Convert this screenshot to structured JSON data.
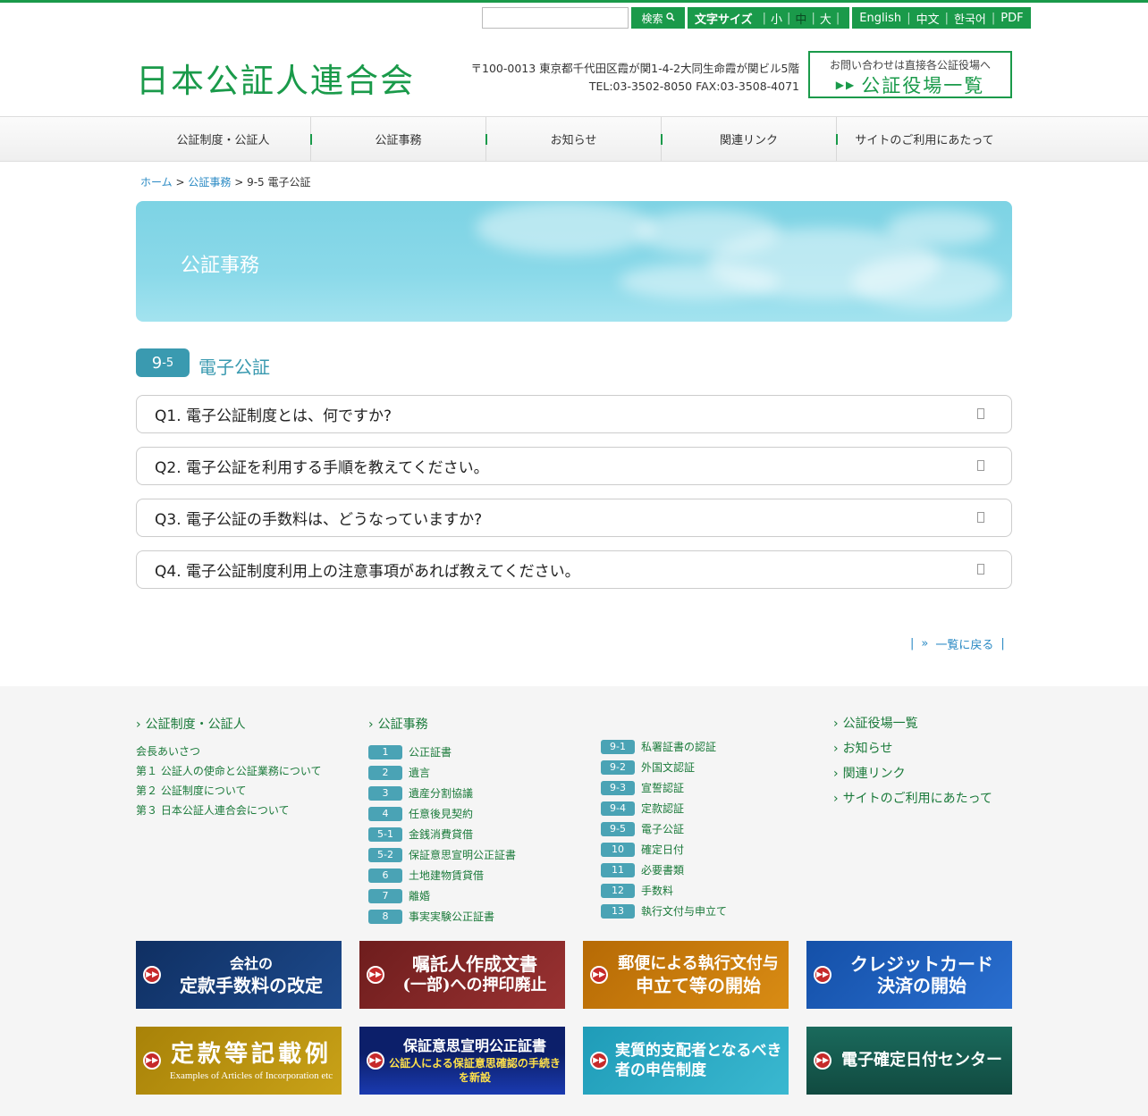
{
  "colors": {
    "brand": "#1a9a4a",
    "accent": "#3a9ab0",
    "link": "#2a8ac4"
  },
  "util": {
    "search_label": "検索",
    "fontsize_label": "文字サイズ",
    "fontsize_small": "小",
    "fontsize_medium": "中",
    "fontsize_large": "大",
    "fontsize_selected": "中",
    "langs": [
      "English",
      "中文",
      "한국어",
      "PDF"
    ]
  },
  "header": {
    "logo": "日本公証人連合会",
    "address1": "〒100-0013 東京都千代田区霞が関1-4-2大同生命霞が関ビル5階",
    "address2": "TEL:03-3502-8050 FAX:03-3508-4071",
    "office_small": "お問い合わせは直接各公証役場へ",
    "office_big": "公証役場一覧"
  },
  "nav": [
    "公証制度・公証人",
    "公証事務",
    "お知らせ",
    "関連リンク",
    "サイトのご利用にあたって"
  ],
  "breadcrumb": {
    "home": "ホーム",
    "sep": ">",
    "parent": "公証事務",
    "current": "9-5 電子公証"
  },
  "hero_title": "公証事務",
  "section": {
    "badge_main": "9",
    "badge_sub": "-5",
    "title": "電子公証"
  },
  "faqs": [
    "Q1. 電子公証制度とは、何ですか?",
    "Q2. 電子公証を利用する手順を教えてください。",
    "Q3. 電子公証の手数料は、どうなっていますか?",
    "Q4. 電子公証制度利用上の注意事項があれば教えてください。"
  ],
  "back_link": "一覧に戻る",
  "footer": {
    "col1_head": "公証制度・公証人",
    "col1_links": [
      "会長あいさつ",
      "第１ 公証人の使命と公証業務について",
      "第２ 公証制度について",
      "第３ 日本公証人連合会について"
    ],
    "col2_head": "公証事務",
    "col2_items": [
      {
        "num": "1",
        "label": "公正証書"
      },
      {
        "num": "2",
        "label": "遺言"
      },
      {
        "num": "3",
        "label": "遺産分割協議"
      },
      {
        "num": "4",
        "label": "任意後見契約"
      },
      {
        "num": "5-1",
        "label": "金銭消費貸借"
      },
      {
        "num": "5-2",
        "label": "保証意思宣明公正証書"
      },
      {
        "num": "6",
        "label": "土地建物賃貸借"
      },
      {
        "num": "7",
        "label": "離婚"
      },
      {
        "num": "8",
        "label": "事実実験公正証書"
      }
    ],
    "col3_items": [
      {
        "num": "9-1",
        "label": "私署証書の認証"
      },
      {
        "num": "9-2",
        "label": "外国文認証"
      },
      {
        "num": "9-3",
        "label": "宣誓認証"
      },
      {
        "num": "9-4",
        "label": "定款認証"
      },
      {
        "num": "9-5",
        "label": "電子公証"
      },
      {
        "num": "10",
        "label": "確定日付"
      },
      {
        "num": "11",
        "label": "必要書類"
      },
      {
        "num": "12",
        "label": "手数料"
      },
      {
        "num": "13",
        "label": "執行文付与申立て"
      }
    ],
    "col4_links": [
      "公証役場一覧",
      "お知らせ",
      "関連リンク",
      "サイトのご利用にあたって"
    ]
  },
  "banners": [
    {
      "line1": "会社の",
      "line2": "定款手数料の改定",
      "color": "#143a72"
    },
    {
      "line1": "嘱託人作成文書",
      "line2": "(一部)への押印廃止",
      "color": "#8a2a2a"
    },
    {
      "line1": "郵便による執行文付与",
      "line2": "申立て等の開始",
      "color": "#c8780a"
    },
    {
      "line1": "クレジットカード",
      "line2": "決済の開始",
      "color": "#1a5cb8"
    },
    {
      "line1": "定款等記載例",
      "line2": "Examples of Articles of Incorporation etc",
      "color": "#b89210"
    },
    {
      "line1": "保証意思宣明公正証書",
      "line2": "公証人による保証意思確認の手続きを新設",
      "color": "#0c1f6a"
    },
    {
      "line1": "実質的支配者となるべき",
      "line2": "者の申告制度",
      "color": "#2aaac4"
    },
    {
      "line1": "電子確定日付センター",
      "line2": "",
      "color": "#165a4e"
    }
  ]
}
